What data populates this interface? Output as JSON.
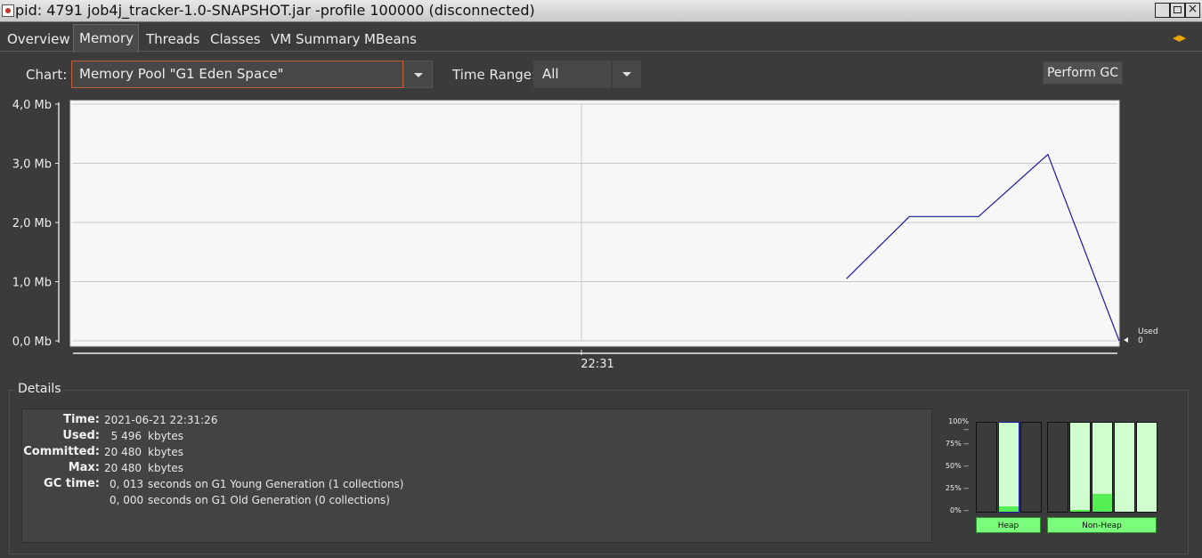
{
  "window": {
    "title": "pid: 4791 job4j_tracker-1.0-SNAPSHOT.jar -profile 100000 (disconnected)"
  },
  "tabs": [
    "Overview",
    "Memory",
    "Threads",
    "Classes",
    "VM Summary",
    "MBeans"
  ],
  "active_tab": "Memory",
  "controls": {
    "chart_label": "Chart:",
    "chart_value": "Memory Pool \"G1 Eden Space\"",
    "time_range_label": "Time Range:",
    "time_range_value": "All",
    "gc_button": "Perform GC"
  },
  "chart_data": {
    "type": "line",
    "y_ticks": [
      "4,0 Mb",
      "3,0 Mb",
      "2,0 Mb",
      "1,0 Mb",
      "0,0 Mb"
    ],
    "ylim": [
      0,
      4.0
    ],
    "x_tick": "22:31",
    "series": [
      {
        "name": "Used",
        "last_value": "0",
        "color": "#1a1aa0",
        "x_fraction": [
          0.74,
          0.8,
          0.866,
          0.932,
          1.0
        ],
        "values": [
          1.05,
          2.1,
          2.1,
          3.15,
          0.0
        ]
      }
    ],
    "grid": true
  },
  "details": {
    "title": "Details",
    "time_label": "Time:",
    "time_value": "2021-06-21 22:31:26",
    "used_label": "Used:",
    "used_num": "5 496",
    "used_unit": "kbytes",
    "committed_label": "Committed:",
    "committed_num": "20 480",
    "committed_unit": "kbytes",
    "max_label": "Max:",
    "max_num": "20 480",
    "max_unit": "kbytes",
    "gc_label": "GC time:",
    "gc_young_num": "0, 013",
    "gc_young_text": "seconds on G1 Young Generation (1 collections)",
    "gc_old_num": "0, 000",
    "gc_old_text": "seconds on G1 Old Generation (0 collections)"
  },
  "pool_bars": {
    "percent_ticks": [
      "100% --",
      "75% --",
      "50% --",
      "25% --",
      "0% --"
    ],
    "heap_label": "Heap",
    "nonheap_label": "Non-Heap",
    "heap": [
      {
        "committed": 0.0,
        "used": 0.0
      },
      {
        "committed": 1.0,
        "used": 0.06,
        "selected": true
      },
      {
        "committed": 0.0,
        "used": 0.0
      }
    ],
    "nonheap": [
      {
        "committed": 0.0,
        "used": 0.0
      },
      {
        "committed": 1.0,
        "used": 0.02
      },
      {
        "committed": 1.0,
        "used": 0.2
      },
      {
        "committed": 1.0,
        "used": 0.0
      },
      {
        "committed": 1.0,
        "used": 0.0
      }
    ]
  }
}
